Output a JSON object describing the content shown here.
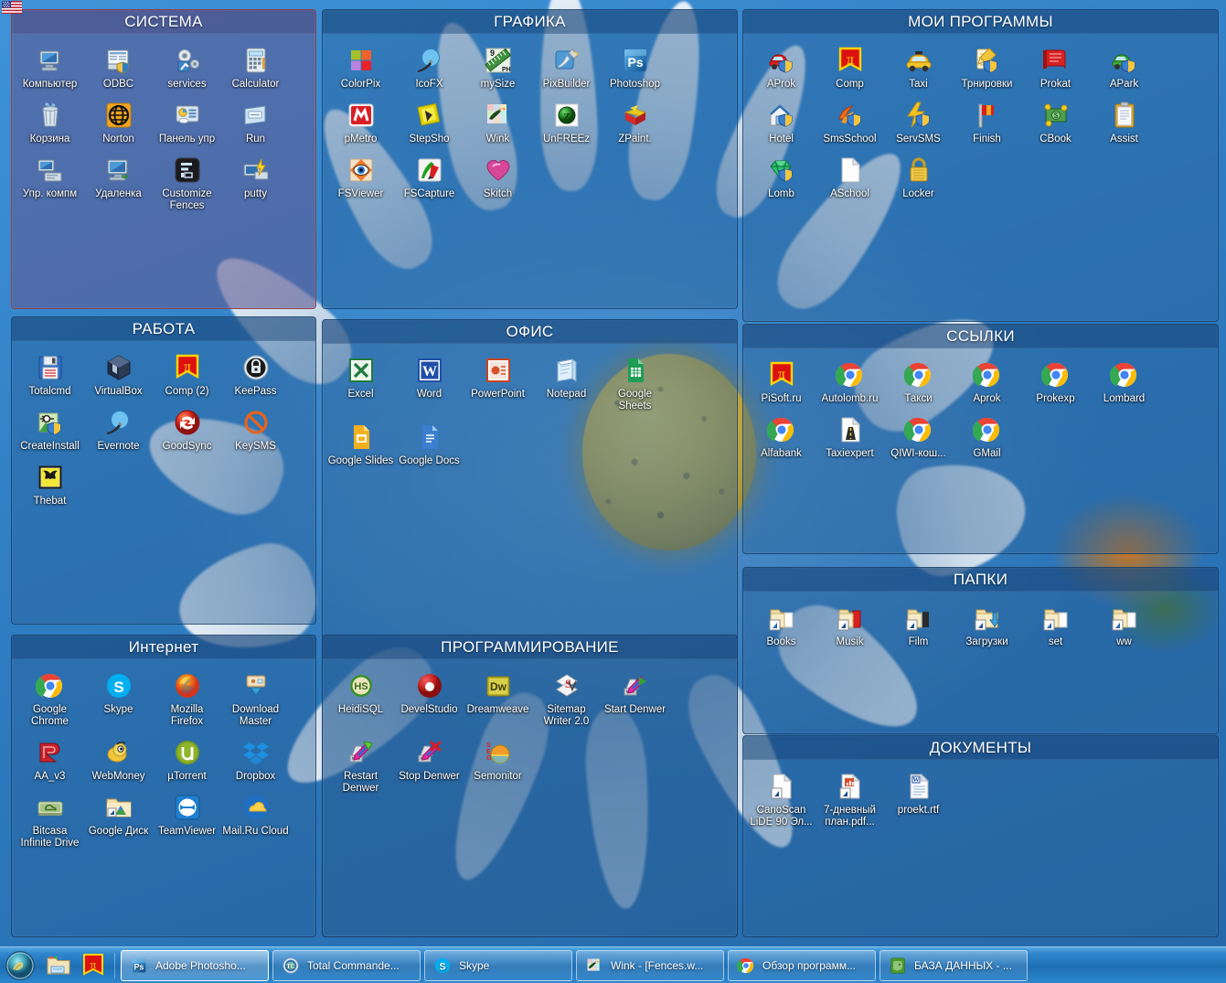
{
  "desktop": {
    "wallpaper_description": "close-up white daisy flower with yellow center on blue sky",
    "language_indicator": "EN"
  },
  "colors": {
    "fence_fill": "#286096",
    "fence_selected_fill": "#5c5c94",
    "fence_header": "#143e70",
    "taskbar": "#1e6fb4",
    "label_text": "#ffffff"
  },
  "fences": [
    {
      "id": "sistema",
      "title": "СИСТЕМА",
      "selected": true,
      "icons": [
        {
          "label": "Компьютер",
          "icon": "computer-icon"
        },
        {
          "label": "ODBC",
          "icon": "odbc-icon"
        },
        {
          "label": "services",
          "icon": "services-gear-icon"
        },
        {
          "label": "Calculator",
          "icon": "calculator-icon"
        },
        {
          "label": "Корзина",
          "icon": "recycle-bin-icon"
        },
        {
          "label": "Norton",
          "icon": "norton-globe-icon"
        },
        {
          "label": "Панель упр",
          "icon": "control-panel-icon"
        },
        {
          "label": "Run",
          "icon": "run-dialog-icon"
        },
        {
          "label": "Упр. компм",
          "icon": "computer-management-icon"
        },
        {
          "label": "Удаленка",
          "icon": "remote-desktop-icon"
        },
        {
          "label": "Customize Fences",
          "icon": "fences-icon"
        },
        {
          "label": "putty",
          "icon": "putty-icon"
        }
      ]
    },
    {
      "id": "grafika",
      "title": "ГРАФИКА",
      "selected": false,
      "icons": [
        {
          "label": "ColorPix",
          "icon": "colorpix-squares-icon"
        },
        {
          "label": "IcoFX",
          "icon": "icofx-brush-icon"
        },
        {
          "label": "mySize",
          "icon": "mysize-ruler-icon"
        },
        {
          "label": "PixBuilder",
          "icon": "pixbuilder-brush-icon"
        },
        {
          "label": "Photoshop",
          "icon": "photoshop-ps-icon"
        },
        {
          "label": "pMetro",
          "icon": "pmetro-m-icon"
        },
        {
          "label": "StepSho",
          "icon": "stepshot-icon"
        },
        {
          "label": "Wink",
          "icon": "wink-frog-icon"
        },
        {
          "label": "UnFREEz",
          "icon": "unfreez-ball-icon"
        },
        {
          "label": "ZPaint.",
          "icon": "zpaint-icon"
        },
        {
          "label": "FSViewer",
          "icon": "fsviewer-eye-icon"
        },
        {
          "label": "FSCapture",
          "icon": "fscapture-icon"
        },
        {
          "label": "Skitch",
          "icon": "skitch-heart-icon"
        }
      ]
    },
    {
      "id": "moi-programmy",
      "title": "МОИ ПРОГРАММЫ",
      "selected": false,
      "icons": [
        {
          "label": "AProk",
          "icon": "red-car-shield-icon"
        },
        {
          "label": "Comp",
          "icon": "pi-flag-icon"
        },
        {
          "label": "Taxi",
          "icon": "taxi-car-icon"
        },
        {
          "label": "Трнировки",
          "icon": "notebook-pencil-shield-icon"
        },
        {
          "label": "Prokat",
          "icon": "red-book-icon"
        },
        {
          "label": "APark",
          "icon": "green-car-shield-icon"
        },
        {
          "label": "Hotel",
          "icon": "house-shield-icon"
        },
        {
          "label": "SmsSchool",
          "icon": "orange-sms-shield-icon"
        },
        {
          "label": "ServSMS",
          "icon": "lightning-shield-icon"
        },
        {
          "label": "Finish",
          "icon": "flag-icon"
        },
        {
          "label": "CBook",
          "icon": "money-icon"
        },
        {
          "label": "Assist",
          "icon": "clipboard-icon"
        },
        {
          "label": "Lomb",
          "icon": "gem-shield-icon"
        },
        {
          "label": "ASchool",
          "icon": "blank-document-icon"
        },
        {
          "label": "Locker",
          "icon": "padlock-icon"
        }
      ]
    },
    {
      "id": "rabota",
      "title": "РАБОТА",
      "selected": false,
      "icons": [
        {
          "label": "Totalcmd",
          "icon": "floppy-disk-icon"
        },
        {
          "label": "VirtualBox",
          "icon": "virtualbox-icon"
        },
        {
          "label": "Comp (2)",
          "icon": "pi-flag-icon"
        },
        {
          "label": "KeePass",
          "icon": "keepass-lock-icon"
        },
        {
          "label": "CreateInstall",
          "icon": "createinstall-icon"
        },
        {
          "label": "Evernote",
          "icon": "icofx-brush-icon"
        },
        {
          "label": "GoodSync",
          "icon": "goodsync-arrow-icon"
        },
        {
          "label": "KeySMS",
          "icon": "no-entry-icon"
        },
        {
          "label": "Thebat",
          "icon": "thebat-icon"
        }
      ]
    },
    {
      "id": "ofis",
      "title": "ОФИС",
      "selected": false,
      "icons": [
        {
          "label": "Excel",
          "icon": "excel-icon"
        },
        {
          "label": "Word",
          "icon": "word-icon"
        },
        {
          "label": "PowerPoint",
          "icon": "powerpoint-icon"
        },
        {
          "label": "Notepad",
          "icon": "notepad-icon"
        },
        {
          "label": "Google Sheets",
          "icon": "google-sheets-icon"
        },
        {
          "label": "Google Slides",
          "icon": "google-slides-icon"
        },
        {
          "label": "Google Docs",
          "icon": "google-docs-icon"
        }
      ]
    },
    {
      "id": "ssylki",
      "title": "ССЫЛКИ",
      "selected": false,
      "icons": [
        {
          "label": "PiSoft.ru",
          "icon": "pi-flag-icon"
        },
        {
          "label": "Autolomb.ru",
          "icon": "chrome-icon"
        },
        {
          "label": "Такси",
          "icon": "chrome-icon"
        },
        {
          "label": "Aprok",
          "icon": "chrome-icon"
        },
        {
          "label": "Prokexp",
          "icon": "chrome-icon"
        },
        {
          "label": "Lombard",
          "icon": "chrome-icon"
        },
        {
          "label": "Alfabank",
          "icon": "chrome-icon"
        },
        {
          "label": "Taxiexpert",
          "icon": "road-document-icon"
        },
        {
          "label": "QIWI-кош...",
          "icon": "chrome-icon"
        },
        {
          "label": "GMail",
          "icon": "chrome-icon"
        }
      ]
    },
    {
      "id": "internet",
      "title": "Интернет",
      "selected": false,
      "icons": [
        {
          "label": "Google Chrome",
          "icon": "chrome-icon"
        },
        {
          "label": "Skype",
          "icon": "skype-icon"
        },
        {
          "label": "Mozilla Firefox",
          "icon": "firefox-icon"
        },
        {
          "label": "Download Master",
          "icon": "download-master-icon"
        },
        {
          "label": "AA_v3",
          "icon": "aa-v3-icon"
        },
        {
          "label": "WebMoney",
          "icon": "webmoney-icon"
        },
        {
          "label": "µTorrent",
          "icon": "utorrent-icon"
        },
        {
          "label": "Dropbox",
          "icon": "dropbox-icon"
        },
        {
          "label": "Bitcasa Infinite Drive",
          "icon": "bitcasa-icon"
        },
        {
          "label": "Google Диск",
          "icon": "google-drive-folder-icon"
        },
        {
          "label": "TeamViewer",
          "icon": "teamviewer-icon"
        },
        {
          "label": "Mail.Ru Cloud",
          "icon": "mailru-cloud-icon"
        }
      ]
    },
    {
      "id": "programmirovanie",
      "title": "ПРОГРАММИРОВАНИЕ",
      "selected": false,
      "icons": [
        {
          "label": "HeidiSQL",
          "icon": "heidisql-icon"
        },
        {
          "label": "DevelStudio",
          "icon": "develstudio-icon"
        },
        {
          "label": "Dreamweave",
          "icon": "dreamweaver-icon"
        },
        {
          "label": "Sitemap Writer 2.0",
          "icon": "sitemap-writer-icon"
        },
        {
          "label": "Start Denwer",
          "icon": "denwer-start-icon"
        },
        {
          "label": "Restart Denwer",
          "icon": "denwer-restart-icon"
        },
        {
          "label": "Stop Denwer",
          "icon": "denwer-stop-icon"
        },
        {
          "label": "Semonitor",
          "icon": "semonitor-icon"
        }
      ]
    },
    {
      "id": "papki",
      "title": "ПАПКИ",
      "selected": false,
      "icons": [
        {
          "label": "Books",
          "icon": "folder-shortcut-icon"
        },
        {
          "label": "Musik",
          "icon": "folder-music-shortcut-icon"
        },
        {
          "label": "Film",
          "icon": "folder-film-shortcut-icon"
        },
        {
          "label": "Загрузки",
          "icon": "folder-downloads-shortcut-icon"
        },
        {
          "label": "set",
          "icon": "folder-shortcut-icon"
        },
        {
          "label": "ww",
          "icon": "folder-shortcut-icon"
        }
      ]
    },
    {
      "id": "dokumenty",
      "title": "ДОКУМЕНТЫ",
      "selected": false,
      "icons": [
        {
          "label": "CanoScan LiDE 90 Эл...",
          "icon": "document-shortcut-icon"
        },
        {
          "label": "7-дневный план.pdf...",
          "icon": "pdf-shortcut-icon"
        },
        {
          "label": "proekt.rtf",
          "icon": "rtf-document-icon"
        }
      ]
    }
  ],
  "taskbar": {
    "start_button": "start-orb",
    "quick_launch": [
      {
        "label": "Explorer",
        "icon": "explorer-folder-icon"
      },
      {
        "label": "PiSoft",
        "icon": "pi-flag-icon"
      }
    ],
    "windows": [
      {
        "label": "Adobe Photosho...",
        "icon": "photoshop-ps-icon",
        "active": true
      },
      {
        "label": "Total Commande...",
        "icon": "total-commander-icon",
        "active": false
      },
      {
        "label": "Skype",
        "icon": "skype-icon",
        "active": false
      },
      {
        "label": "Wink - [Fences.w...",
        "icon": "wink-frog-icon",
        "active": false
      },
      {
        "label": "Обзор программ...",
        "icon": "chrome-icon",
        "active": false
      },
      {
        "label": "БАЗА ДАННЫХ - ...",
        "icon": "evernote-elephant-icon",
        "active": false
      }
    ]
  }
}
